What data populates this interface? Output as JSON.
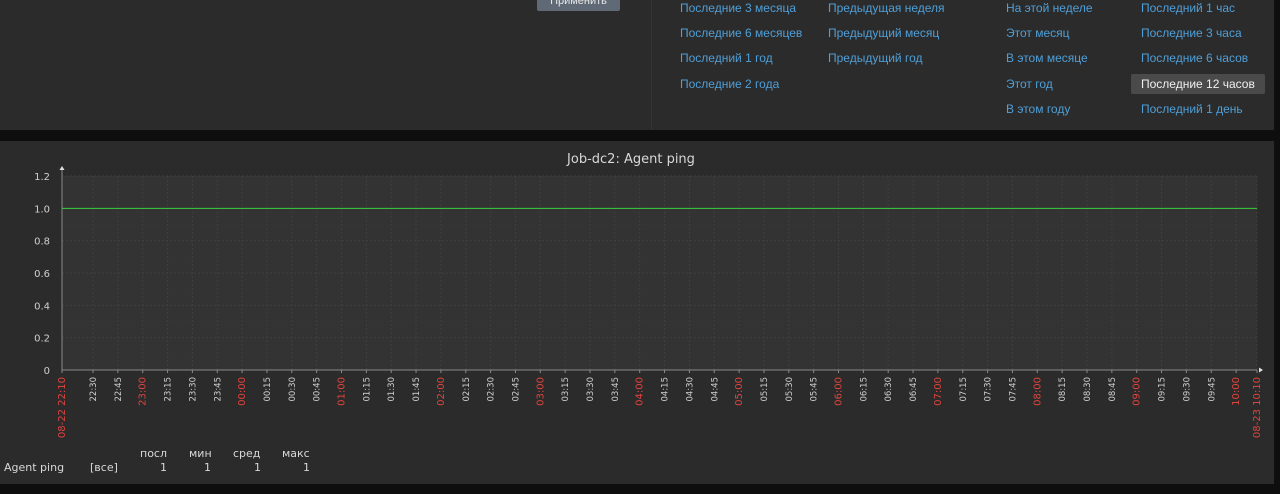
{
  "filter": {
    "apply_label": "Применить",
    "quick_ranges": [
      {
        "label": "Последние 3 месяца",
        "active": false
      },
      {
        "label": "Последние 6 месяцев",
        "active": false
      },
      {
        "label": "Последний 1 год",
        "active": false
      },
      {
        "label": "Последние 2 года",
        "active": false
      },
      {
        "label": "Предыдущая неделя",
        "active": false
      },
      {
        "label": "Предыдущий месяц",
        "active": false
      },
      {
        "label": "Предыдущий год",
        "active": false
      },
      {
        "label": "На этой неделе",
        "active": false
      },
      {
        "label": "Этот месяц",
        "active": false
      },
      {
        "label": "В этом месяце",
        "active": false
      },
      {
        "label": "Этот год",
        "active": false
      },
      {
        "label": "В этом году",
        "active": false
      },
      {
        "label": "Последний 1 час",
        "active": false
      },
      {
        "label": "Последние 3 часа",
        "active": false
      },
      {
        "label": "Последние 6 часов",
        "active": false
      },
      {
        "label": "Последние 12 часов",
        "active": true
      },
      {
        "label": "Последний 1 день",
        "active": false
      }
    ],
    "link_color": "#4f9fd8"
  },
  "chart_data": {
    "type": "line",
    "title": "Job-dc2: Agent ping",
    "ylim": [
      0,
      1.2
    ],
    "y_ticks": [
      "0",
      "0.2",
      "0.4",
      "0.6",
      "0.8",
      "1.0",
      "1.2"
    ],
    "x_ticks": [
      {
        "label": "08-22 22:10",
        "highlight": true
      },
      {
        "label": "22:30",
        "highlight": false
      },
      {
        "label": "22:45",
        "highlight": false
      },
      {
        "label": "23:00",
        "highlight": true
      },
      {
        "label": "23:15",
        "highlight": false
      },
      {
        "label": "23:30",
        "highlight": false
      },
      {
        "label": "23:45",
        "highlight": false
      },
      {
        "label": "00:00",
        "highlight": true
      },
      {
        "label": "00:15",
        "highlight": false
      },
      {
        "label": "00:30",
        "highlight": false
      },
      {
        "label": "00:45",
        "highlight": false
      },
      {
        "label": "01:00",
        "highlight": true
      },
      {
        "label": "01:15",
        "highlight": false
      },
      {
        "label": "01:30",
        "highlight": false
      },
      {
        "label": "01:45",
        "highlight": false
      },
      {
        "label": "02:00",
        "highlight": true
      },
      {
        "label": "02:15",
        "highlight": false
      },
      {
        "label": "02:30",
        "highlight": false
      },
      {
        "label": "02:45",
        "highlight": false
      },
      {
        "label": "03:00",
        "highlight": true
      },
      {
        "label": "03:15",
        "highlight": false
      },
      {
        "label": "03:30",
        "highlight": false
      },
      {
        "label": "03:45",
        "highlight": false
      },
      {
        "label": "04:00",
        "highlight": true
      },
      {
        "label": "04:15",
        "highlight": false
      },
      {
        "label": "04:30",
        "highlight": false
      },
      {
        "label": "04:45",
        "highlight": false
      },
      {
        "label": "05:00",
        "highlight": true
      },
      {
        "label": "05:15",
        "highlight": false
      },
      {
        "label": "05:30",
        "highlight": false
      },
      {
        "label": "05:45",
        "highlight": false
      },
      {
        "label": "06:00",
        "highlight": true
      },
      {
        "label": "06:15",
        "highlight": false
      },
      {
        "label": "06:30",
        "highlight": false
      },
      {
        "label": "06:45",
        "highlight": false
      },
      {
        "label": "07:00",
        "highlight": true
      },
      {
        "label": "07:15",
        "highlight": false
      },
      {
        "label": "07:30",
        "highlight": false
      },
      {
        "label": "07:45",
        "highlight": false
      },
      {
        "label": "08:00",
        "highlight": true
      },
      {
        "label": "08:15",
        "highlight": false
      },
      {
        "label": "08:30",
        "highlight": false
      },
      {
        "label": "08:45",
        "highlight": false
      },
      {
        "label": "09:00",
        "highlight": true
      },
      {
        "label": "09:15",
        "highlight": false
      },
      {
        "label": "09:30",
        "highlight": false
      },
      {
        "label": "09:45",
        "highlight": false
      },
      {
        "label": "10:00",
        "highlight": true
      },
      {
        "label": "08-23 10:10",
        "highlight": true
      }
    ],
    "x_range": [
      "08-22 22:10",
      "08-23 10:10"
    ],
    "series": [
      {
        "name": "Agent ping",
        "color": "#3ad13a",
        "values": [
          1,
          1
        ]
      }
    ],
    "grid": true,
    "colors": {
      "highlight_tick": "#e0443e",
      "tick": "#cfcfcf",
      "grid": "#3f3f3f",
      "axis": "#8a8a8a"
    }
  },
  "legend": {
    "headers": [
      "посл",
      "мин",
      "сред",
      "макс"
    ],
    "rows": [
      {
        "name": "Agent ping",
        "func": "[все]",
        "last": "1",
        "min": "1",
        "avg": "1",
        "max": "1"
      }
    ]
  }
}
